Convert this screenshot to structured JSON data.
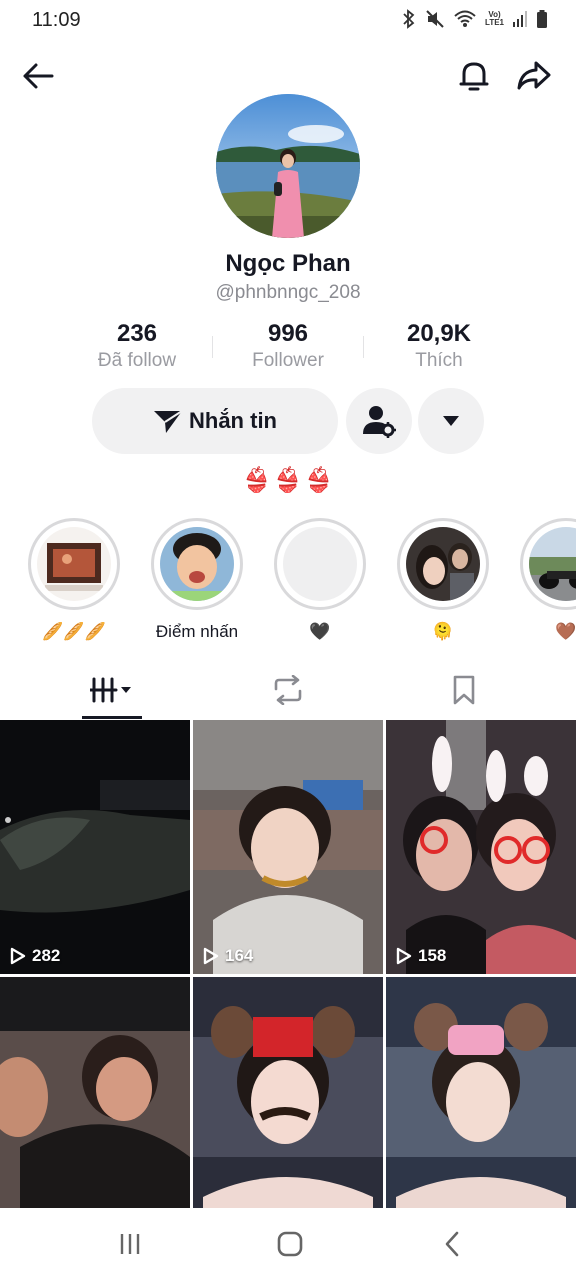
{
  "status_bar": {
    "time": "11:09",
    "network_top": "Vo)",
    "network_bottom": "LTE1"
  },
  "nav": {
    "back_icon": "arrow-left-icon",
    "bell_icon": "bell-icon",
    "share_icon": "share-arrow-icon"
  },
  "profile": {
    "display_name": "Ngọc Phan",
    "username": "@phnbnngc_208",
    "bio": "👙👙👙"
  },
  "stats": [
    {
      "value": "236",
      "label": "Đã follow"
    },
    {
      "value": "996",
      "label": "Follower"
    },
    {
      "value": "20,9K",
      "label": "Thích"
    }
  ],
  "actions": {
    "message_label": "Nhắn tin"
  },
  "highlights": [
    {
      "label": "🥖🥖🥖"
    },
    {
      "label": "Điểm nhấn"
    },
    {
      "label": "🖤"
    },
    {
      "label": "🫠"
    },
    {
      "label": "🤎"
    }
  ],
  "videos": [
    {
      "views": "282"
    },
    {
      "views": "164"
    },
    {
      "views": "158"
    },
    {
      "views": ""
    },
    {
      "views": ""
    },
    {
      "views": ""
    }
  ]
}
